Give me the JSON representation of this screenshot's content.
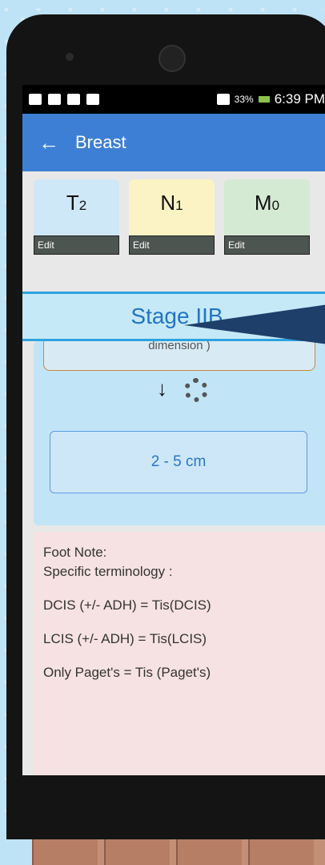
{
  "status_bar": {
    "time": "6:39 PM",
    "battery": "33%"
  },
  "app_bar": {
    "title": "Breast",
    "back_icon": "arrow-left-icon"
  },
  "tnm": [
    {
      "letter": "T",
      "sub": "2",
      "edit": "Edit",
      "color": "#cfe8f8"
    },
    {
      "letter": "N",
      "sub": "1",
      "edit": "Edit",
      "color": "#fbf3c3"
    },
    {
      "letter": "M",
      "sub": "0",
      "edit": "Edit",
      "color": "#d5ead3"
    }
  ],
  "stage": "Stage IIB",
  "flow": {
    "prev_box_text": "dimension )",
    "arrow": "↓",
    "result": "2 - 5 cm"
  },
  "footnote": {
    "title": "Foot Note:",
    "subtitle": "Specific terminology :",
    "lines": [
      "DCIS (+/- ADH) = Tis(DCIS)",
      "LCIS (+/- ADH) = Tis(LCIS)",
      "Only Paget's = Tis (Paget's)"
    ]
  }
}
